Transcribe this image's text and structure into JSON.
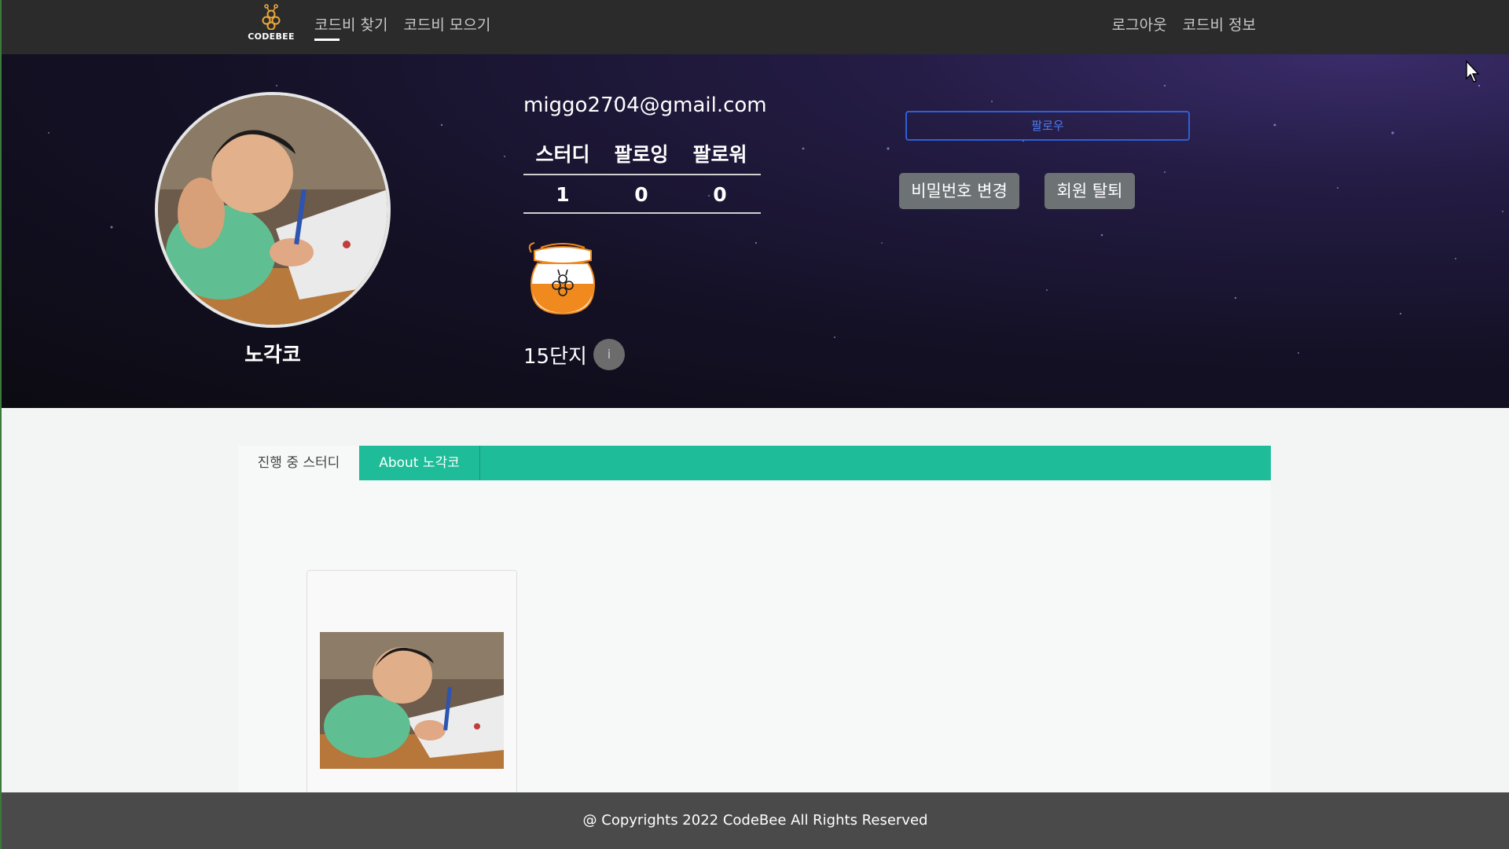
{
  "navbar": {
    "logo_text": "CODEBEE",
    "links_left": [
      {
        "label": "코드비 찾기",
        "active": true
      },
      {
        "label": "코드비 모으기",
        "active": false
      }
    ],
    "links_right": [
      {
        "label": "로그아웃"
      },
      {
        "label": "코드비 정보"
      }
    ]
  },
  "profile": {
    "username": "노각코",
    "email": "miggo2704@gmail.com",
    "stats": {
      "headers": [
        "스터디",
        "팔로잉",
        "팔로워"
      ],
      "values": [
        "1",
        "0",
        "0"
      ]
    },
    "level": "15단지",
    "info_icon": "i",
    "jar_icon": "honey-jar-icon"
  },
  "actions": {
    "follow": "팔로우",
    "change_password": "비밀번호 변경",
    "withdraw": "회원 탈퇴"
  },
  "tabs": [
    {
      "label": "진행 중 스터디",
      "active": true
    },
    {
      "label": "About 노각코",
      "active": false
    }
  ],
  "footer": {
    "copyright": "@ Copyrights 2022 CodeBee All Rights Reserved"
  },
  "colors": {
    "navbar_bg": "#2b2b2b",
    "tab_accent": "#1ebc98",
    "follow_border": "#2d60d8",
    "gray_button": "#6d7275",
    "footer_bg": "#4a4a4a",
    "honey": "#f08a1e"
  }
}
